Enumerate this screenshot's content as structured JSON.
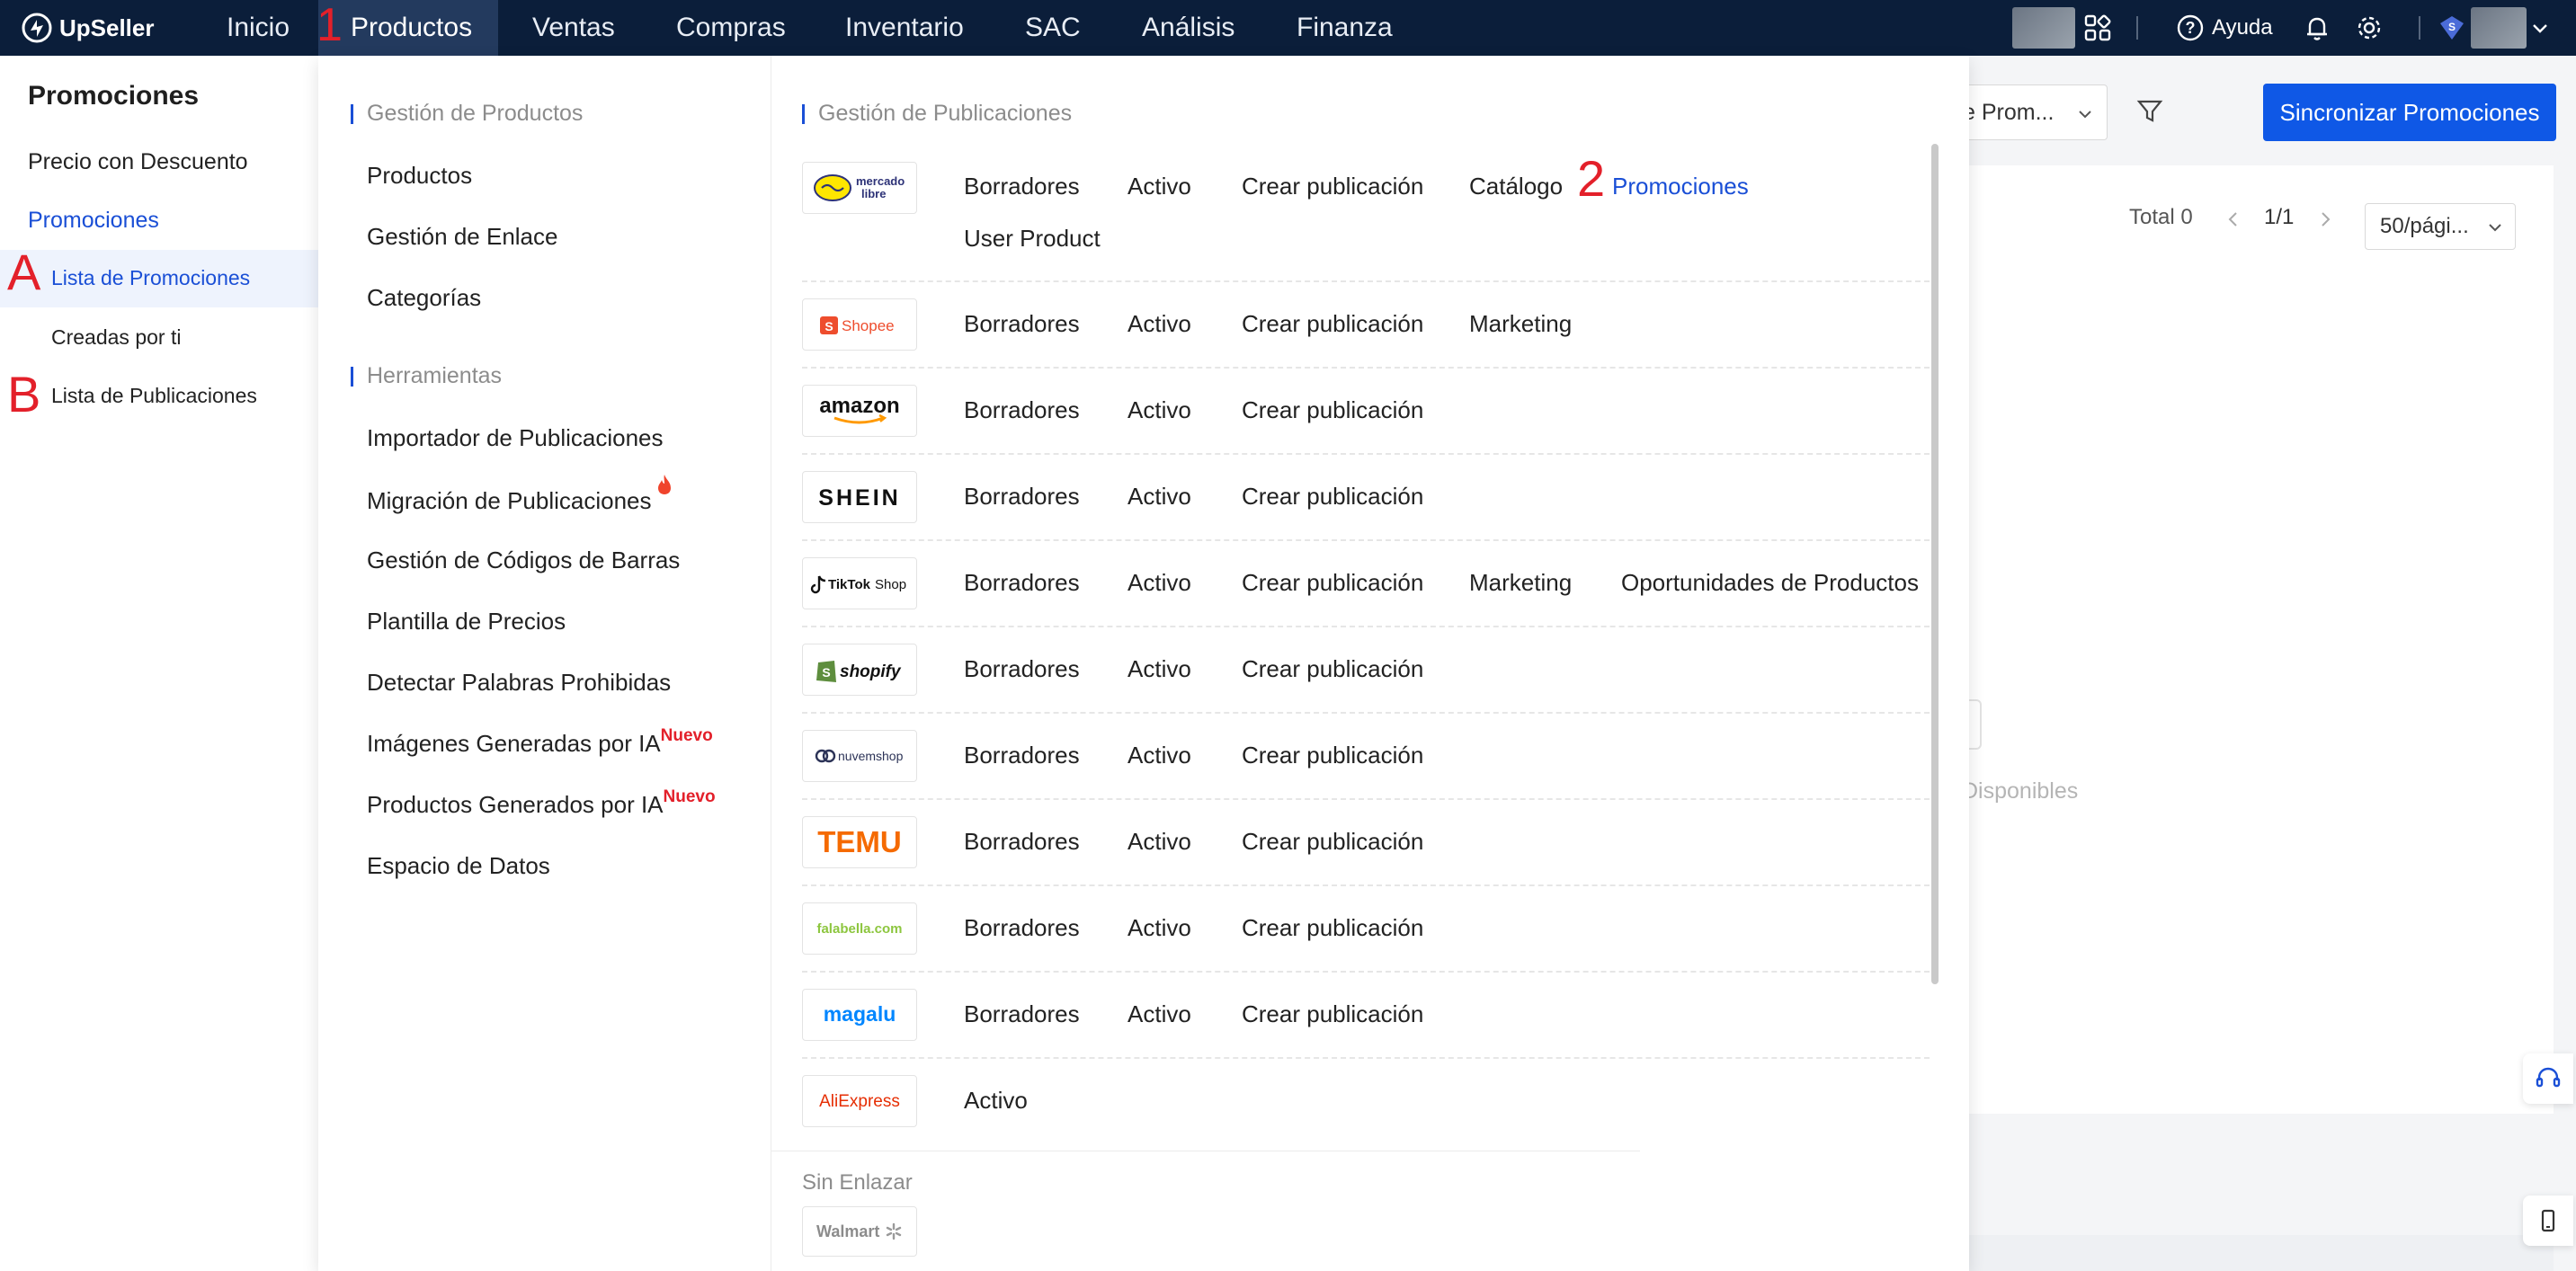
{
  "topbar": {
    "brand": "UpSeller",
    "nav": [
      "Inicio",
      "Productos",
      "Ventas",
      "Compras",
      "Inventario",
      "SAC",
      "Análisis",
      "Finanza"
    ],
    "active_nav": "Productos",
    "help_label": "Ayuda",
    "icons": [
      "apps-grid-icon",
      "help-circle-icon",
      "bell-icon",
      "gear-icon",
      "vip-badge-icon",
      "chevron-down-icon"
    ]
  },
  "annotations": {
    "mark_1": "1",
    "mark_2": "2",
    "mark_a": "A",
    "mark_b": "B"
  },
  "sidebar": {
    "title": "Promociones",
    "items": [
      {
        "label": "Precio con Descuento"
      },
      {
        "label": "Promociones"
      },
      {
        "label": "Lista de Promociones"
      },
      {
        "label": "Creadas por ti"
      },
      {
        "label": "Lista de Publicaciones"
      }
    ]
  },
  "main": {
    "filter_select": "e Prom...",
    "sync_button": "Sincronizar Promociones",
    "total": "Total 0",
    "page": "1/1",
    "page_size": "50/pági...",
    "empty_text": "Disponibles"
  },
  "dropdown": {
    "product_mgmt": {
      "heading": "Gestión de Productos",
      "links": [
        "Productos",
        "Gestión de Enlace",
        "Categorías"
      ]
    },
    "tools": {
      "heading": "Herramientas",
      "links": [
        {
          "label": "Importador de Publicaciones",
          "badge": ""
        },
        {
          "label": "Migración de Publicaciones",
          "badge": ""
        },
        {
          "label": "Gestión de Códigos de Barras",
          "badge": ""
        },
        {
          "label": "Plantilla de Precios",
          "badge": ""
        },
        {
          "label": "Detectar Palabras Prohibidas",
          "badge": ""
        },
        {
          "label": "Imágenes Generadas por IA",
          "badge": "Nuevo"
        },
        {
          "label": "Productos Generados por IA",
          "badge": "Nuevo"
        },
        {
          "label": "Espacio de Datos",
          "badge": ""
        }
      ]
    },
    "publications": {
      "heading": "Gestión de Publicaciones",
      "rows": [
        {
          "platform": "mercado libre",
          "links": [
            "Borradores",
            "Activo",
            "Crear publicación",
            "Catálogo",
            "Promociones",
            "User Product"
          ]
        },
        {
          "platform": "Shopee",
          "links": [
            "Borradores",
            "Activo",
            "Crear publicación",
            "Marketing"
          ]
        },
        {
          "platform": "amazon",
          "links": [
            "Borradores",
            "Activo",
            "Crear publicación"
          ]
        },
        {
          "platform": "SHEIN",
          "links": [
            "Borradores",
            "Activo",
            "Crear publicación"
          ]
        },
        {
          "platform": "TikTok Shop",
          "links": [
            "Borradores",
            "Activo",
            "Crear publicación",
            "Marketing",
            "Oportunidades de Productos"
          ]
        },
        {
          "platform": "shopify",
          "links": [
            "Borradores",
            "Activo",
            "Crear publicación"
          ]
        },
        {
          "platform": "nuvemshop",
          "links": [
            "Borradores",
            "Activo",
            "Crear publicación"
          ]
        },
        {
          "platform": "TEMU",
          "links": [
            "Borradores",
            "Activo",
            "Crear publicación"
          ]
        },
        {
          "platform": "falabella.com",
          "links": [
            "Borradores",
            "Activo",
            "Crear publicación"
          ]
        },
        {
          "platform": "magalu",
          "links": [
            "Borradores",
            "Activo",
            "Crear publicación"
          ]
        },
        {
          "platform": "AliExpress",
          "links": [
            "Activo"
          ]
        }
      ]
    },
    "unlinked": {
      "heading": "Sin Enlazar",
      "platform": "Walmart"
    }
  },
  "colors": {
    "topbar_bg": "#0b1e3a",
    "accent_blue": "#1a4fd6",
    "button_blue": "#0f58e6",
    "annotation_red": "#e3202a"
  }
}
